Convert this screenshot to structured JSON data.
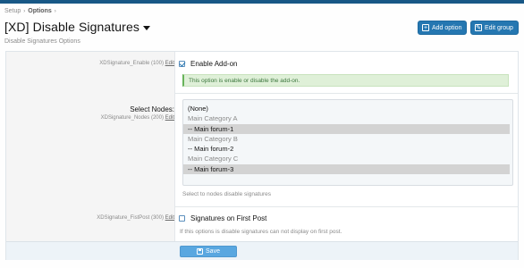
{
  "breadcrumb": {
    "items": [
      "Setup",
      "Options"
    ]
  },
  "page": {
    "title": "[XD] Disable Signatures",
    "subtitle": "Disable Signatures Options"
  },
  "actions": {
    "add_option": "Add option",
    "edit_group": "Edit group"
  },
  "options": {
    "enable": {
      "id_label": "XDSignature_Enable (100)",
      "edit": "Edit",
      "checkbox_label": "Enable Add-on",
      "checked": true,
      "note": "This option is enable or disable the add-on."
    },
    "nodes": {
      "label": "Select Nodes:",
      "id_label": "XDSignature_Nodes (200)",
      "edit": "Edit",
      "list": [
        {
          "text": "(None)",
          "kind": "none",
          "selected": false
        },
        {
          "text": "Main Category A",
          "kind": "category",
          "selected": false
        },
        {
          "text": "-- Main forum-1",
          "kind": "forum",
          "selected": true
        },
        {
          "text": "Main Category B",
          "kind": "category",
          "selected": false
        },
        {
          "text": "-- Main forum-2",
          "kind": "forum",
          "selected": false
        },
        {
          "text": "Main Category C",
          "kind": "category",
          "selected": false
        },
        {
          "text": "-- Main forum-3",
          "kind": "forum",
          "selected": true
        }
      ],
      "explain": "Select to nodes disable signatures"
    },
    "first_post": {
      "id_label": "XDSignature_FistPost (300)",
      "edit": "Edit",
      "checkbox_label": "Signatures on First Post",
      "checked": false,
      "explain": "If this options is disable signatures can not display on first post."
    }
  },
  "footer": {
    "save_label": "Save"
  },
  "colors": {
    "accent": "#2577b1",
    "topbar": "#185886",
    "save": "#59a7e0",
    "note_bg": "#dff0d8"
  }
}
